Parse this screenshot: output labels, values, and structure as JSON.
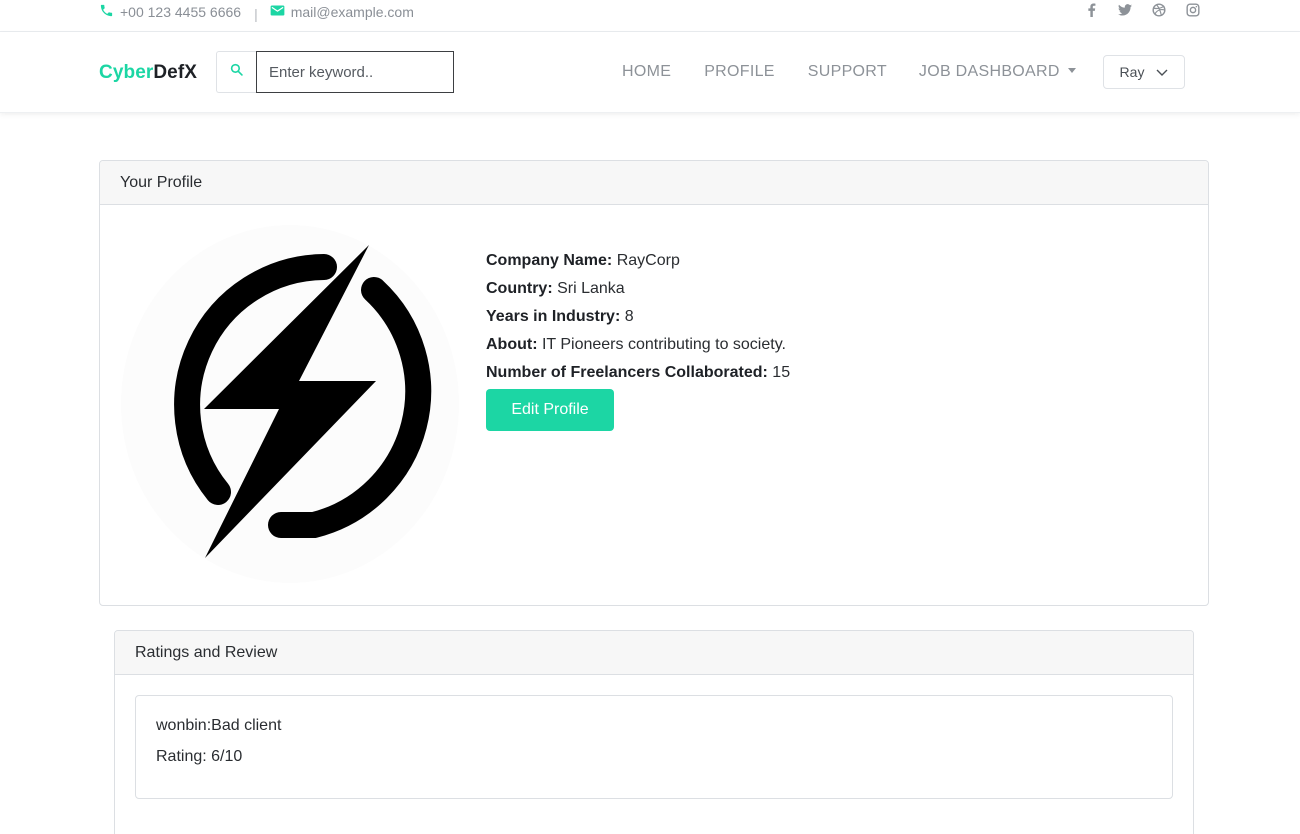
{
  "topbar": {
    "phone": "+00 123 4455 6666",
    "separator": "|",
    "email": "mail@example.com",
    "social_icons": [
      "facebook-icon",
      "twitter-icon",
      "dribbble-icon",
      "instagram-icon"
    ]
  },
  "brand": {
    "part1": "Cyber",
    "part2": "DefX",
    "accent": "#1cd6a4"
  },
  "search": {
    "placeholder": "Enter keyword.."
  },
  "nav": {
    "home": "HOME",
    "profile": "PROFILE",
    "support": "SUPPORT",
    "job_dashboard": "JOB DASHBOARD"
  },
  "user": {
    "name": "Ray"
  },
  "profile": {
    "header": "Your Profile",
    "fields": [
      {
        "label": "Company Name:",
        "value": "RayCorp"
      },
      {
        "label": "Country:",
        "value": "Sri Lanka"
      },
      {
        "label": "Years in Industry:",
        "value": "8"
      },
      {
        "label": "About:",
        "value": "IT Pioneers contributing to society."
      },
      {
        "label": "Number of Freelancers Collaborated:",
        "value": "15"
      }
    ],
    "edit_label": "Edit Profile"
  },
  "reviews": {
    "header": "Ratings and Review",
    "items": [
      {
        "text": "wonbin:Bad client",
        "rating": "Rating: 6/10"
      }
    ]
  }
}
